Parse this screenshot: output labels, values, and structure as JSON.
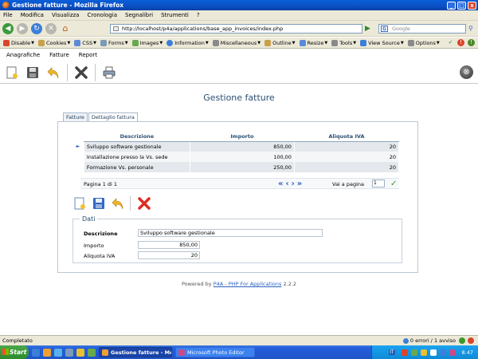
{
  "window": {
    "title": "Gestione fatture - Mozilla Firefox",
    "minimize": "_",
    "maximize": "□",
    "close": "x"
  },
  "firefox_menu": [
    "File",
    "Modifica",
    "Visualizza",
    "Cronologia",
    "Segnalibri",
    "Strumenti",
    "?"
  ],
  "navigation": {
    "url": "http://localhost/p4a/applications/base_app_invoices/index.php",
    "search_placeholder": "Google"
  },
  "devbar_items": [
    {
      "label": "Disable",
      "color": "#d9452b"
    },
    {
      "label": "Cookies",
      "color": "#c9a04a"
    },
    {
      "label": "CSS",
      "color": "#5a8ad8"
    },
    {
      "label": "Forms",
      "color": "#7a9ab8"
    },
    {
      "label": "Images",
      "color": "#6aa84f"
    },
    {
      "label": "Information",
      "color": "#3b7fd8"
    },
    {
      "label": "Miscellaneous",
      "color": "#8a8a8a"
    },
    {
      "label": "Outline",
      "color": "#c9a04a"
    },
    {
      "label": "Resize",
      "color": "#5a8ad8"
    },
    {
      "label": "Tools",
      "color": "#8a8a8a"
    },
    {
      "label": "View Source",
      "color": "#3b7fd8"
    },
    {
      "label": "Options",
      "color": "#8a8a8a"
    }
  ],
  "app_menu": [
    "Anagrafiche",
    "Fatture",
    "Report"
  ],
  "page": {
    "title": "Gestione fatture",
    "tabs": [
      "Fatture",
      "Dettaglio fattura"
    ]
  },
  "grid": {
    "columns": [
      "Descrizione",
      "Importo",
      "Aliquota IVA"
    ],
    "rows": [
      {
        "descrizione": "Sviluppo software gestionale",
        "importo": "850,00",
        "aliquota": "20"
      },
      {
        "descrizione": "Installazione presso la Vs. sede",
        "importo": "100,00",
        "aliquota": "20"
      },
      {
        "descrizione": "Formazione Vs. personale",
        "importo": "250,00",
        "aliquota": "20"
      }
    ],
    "selected_marker": "►"
  },
  "pager": {
    "info": "Pagina 1 di 1",
    "goto_label": "Vai a pagina",
    "page_value": "1"
  },
  "form": {
    "legend": "Dati",
    "descrizione_label": "Descrizione",
    "descrizione_value": "Sviluppo software gestionale",
    "importo_label": "Importo",
    "importo_value": "850,00",
    "aliquota_label": "Aliquota IVA",
    "aliquota_value": "20"
  },
  "footer": {
    "prefix": "Powered by",
    "link": "P4A - PHP For Applications",
    "version": "2.2.2"
  },
  "statusbar": {
    "text": "Completato",
    "errors": "0 errori / 1 avviso"
  },
  "taskbar": {
    "start": "Start",
    "tasks": [
      {
        "label": "Gestione fatture - Mo...",
        "active": true
      },
      {
        "label": "Microsoft Photo Editor",
        "active": false
      }
    ],
    "lang": "IT",
    "clock": "8.47"
  }
}
